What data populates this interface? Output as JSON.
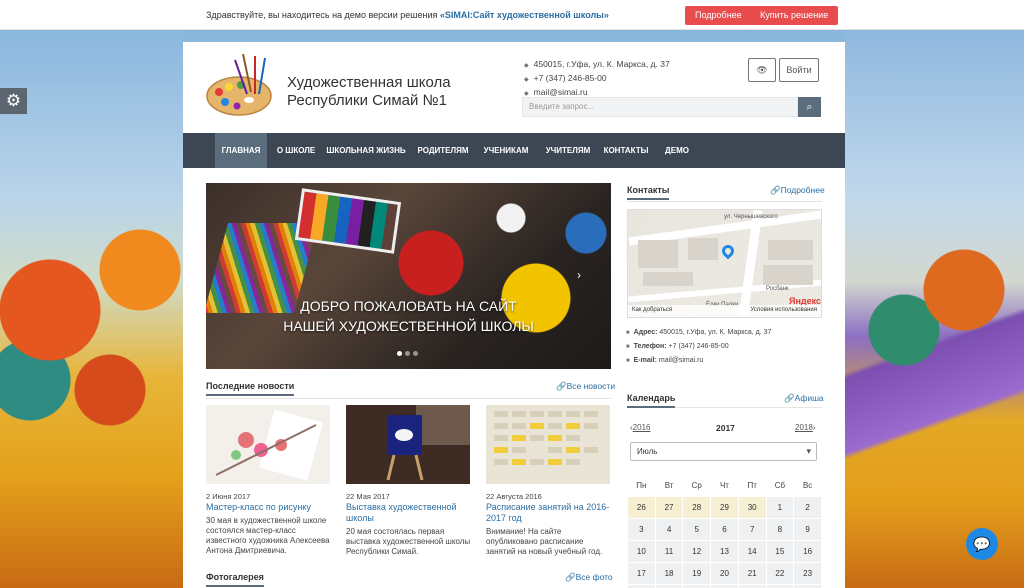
{
  "demo_bar": {
    "text_prefix": "Здравствуйте, вы находитесь на демо версии решения",
    "product_name": "«SIMAI:Сайт художественной школы»",
    "more_button": "Подробнее",
    "buy_button": "Купить решение"
  },
  "header": {
    "title": "Художественная школа Республики Симай №1",
    "address": "450015, г.Уфа, ул. К. Маркса, д. 37",
    "phone": "+7 (347) 246-85-00",
    "email": "mail@simai.ru",
    "login_button": "Войти",
    "search_placeholder": "Введите запрос..."
  },
  "nav": {
    "items": [
      "Главная",
      "О школе",
      "Школьная жизнь",
      "Родителям",
      "Ученикам",
      "Учителям",
      "Контакты",
      "Демо"
    ]
  },
  "slider": {
    "line1": "Добро пожаловать на сайт",
    "line2": "нашей художественной школы"
  },
  "news": {
    "heading": "Последние новости",
    "all_link": "Все новости",
    "items": [
      {
        "date": "2 Июня 2017",
        "title": "Мастер-класс по рисунку",
        "text": "30 мая в художественной школе состоялся мастер-класс известного художника Алексеева Антона Дмитриевича."
      },
      {
        "date": "22 Мая 2017",
        "title": "Выставка художественной школы",
        "text": "20 мая состоялась первая выставка художественной школы Республики Симай."
      },
      {
        "date": "22 Августа 2016",
        "title": "Расписание занятий на 2016-2017 год",
        "text": "Внимание! На сайте опубликовано расписание занятий на новый учебный год."
      }
    ]
  },
  "gallery": {
    "heading": "Фотогалерея",
    "all_link": "Все фото"
  },
  "contacts": {
    "heading": "Контакты",
    "more_link": "Подробнее",
    "address_label": "Адрес:",
    "address": "450015, г.Уфа, ул. К. Маркса, д. 37",
    "phone_label": "Телефон:",
    "phone": "+7 (347) 246-85-00",
    "email_label": "E-mail:",
    "email": "mail@simai.ru",
    "map": {
      "street": "ул. Чернышевского",
      "bank": "Росбанк",
      "park": "Ёлки Палки",
      "route": "Как добраться",
      "terms": "Условия использования",
      "brand": "Яндекс"
    }
  },
  "calendar": {
    "heading": "Календарь",
    "afisha_link": "Афиша",
    "prev_year": "2016",
    "year": "2017",
    "next_year": "2018",
    "month": "Июль",
    "days_of_week": [
      "Пн",
      "Вт",
      "Ср",
      "Чт",
      "Пт",
      "Сб",
      "Вс"
    ],
    "weeks": [
      [
        "26",
        "27",
        "28",
        "29",
        "30",
        "1",
        "2"
      ],
      [
        "3",
        "4",
        "5",
        "6",
        "7",
        "8",
        "9"
      ],
      [
        "10",
        "11",
        "12",
        "13",
        "14",
        "15",
        "16"
      ],
      [
        "17",
        "18",
        "19",
        "20",
        "21",
        "22",
        "23"
      ],
      [
        "24",
        "25",
        "26",
        "27",
        "28",
        "29",
        "30"
      ]
    ]
  },
  "colors": {
    "accent": "#e84c4c",
    "nav_bg": "#3d4753",
    "nav_active": "#5b6d7c",
    "link": "#2b6ea3"
  }
}
